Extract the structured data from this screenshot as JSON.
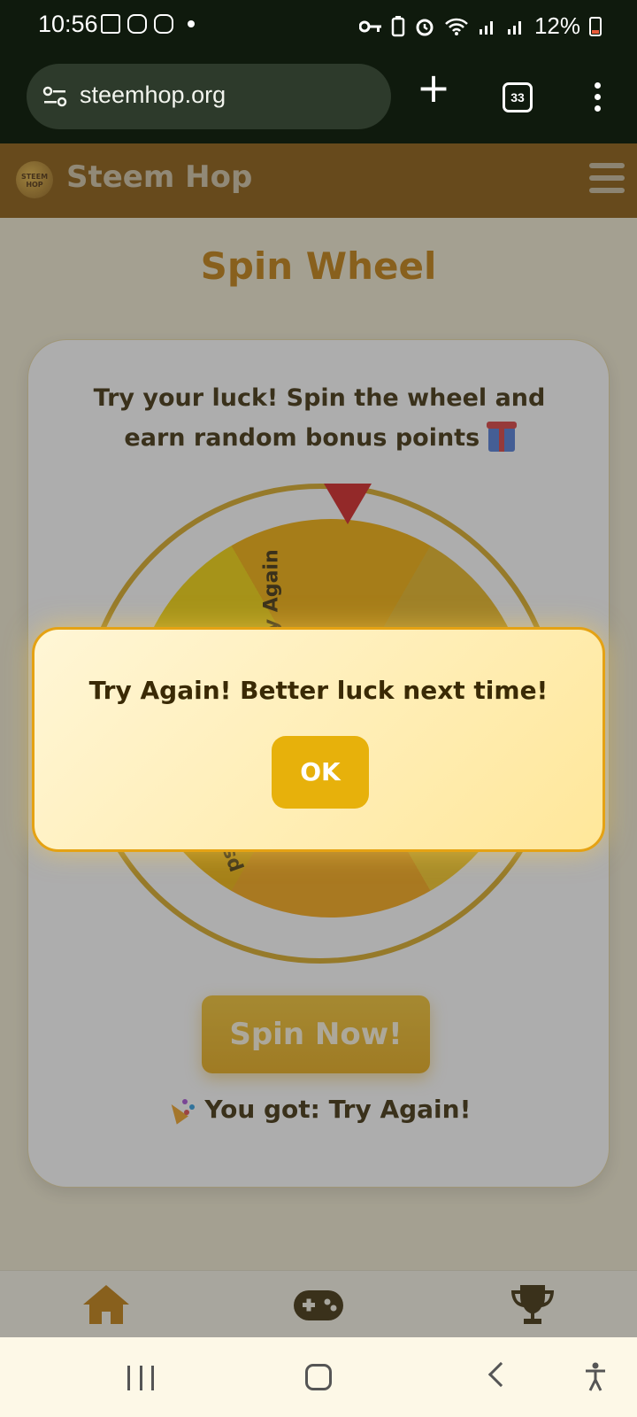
{
  "status_bar": {
    "time": "10:56",
    "battery": "12%"
  },
  "browser": {
    "url": "steemhop.org",
    "tab_count": "33"
  },
  "app": {
    "brand": "Steem Hop",
    "logo_text": "STEEM HOP"
  },
  "page": {
    "title": "Spin Wheel",
    "intro_text": "Try your luck! Spin the wheel and earn random bonus points",
    "spin_button": "Spin Now!",
    "result_text": "You got: Try Again!"
  },
  "wheel": {
    "visible_labels": [
      "Try Again",
      "ps",
      "s"
    ]
  },
  "modal": {
    "message": "Try Again! Better luck next time!",
    "ok_button": "OK"
  },
  "bottom_nav": {
    "items": [
      "home-icon",
      "gamepad-icon",
      "trophy-icon"
    ],
    "accent_color": "#c07b08"
  }
}
